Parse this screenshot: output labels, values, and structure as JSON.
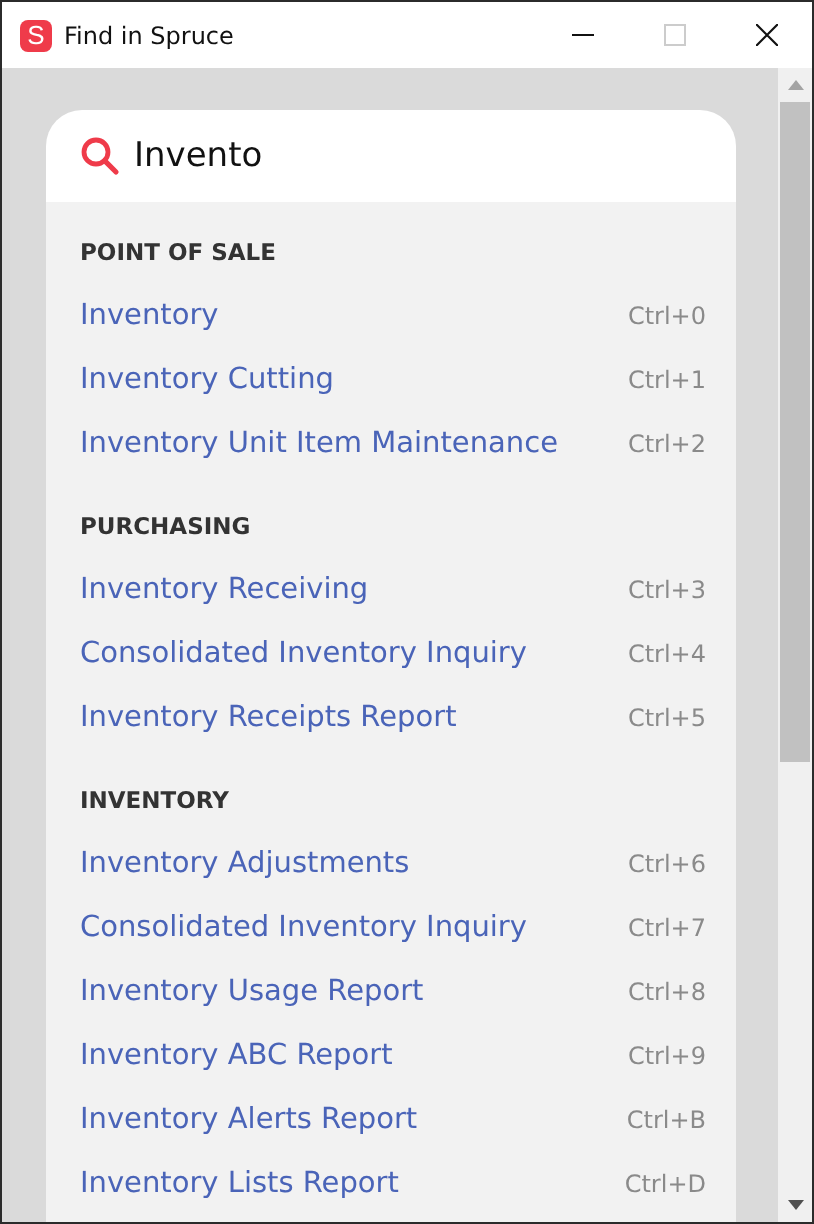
{
  "window": {
    "title": "Find in Spruce",
    "logo": "S"
  },
  "search": {
    "value": "Invento"
  },
  "sections": [
    {
      "header": "POINT OF SALE",
      "items": [
        {
          "label": "Inventory",
          "shortcut": "Ctrl+0"
        },
        {
          "label": "Inventory Cutting",
          "shortcut": "Ctrl+1"
        },
        {
          "label": "Inventory Unit Item Maintenance",
          "shortcut": "Ctrl+2"
        }
      ]
    },
    {
      "header": "PURCHASING",
      "items": [
        {
          "label": "Inventory Receiving",
          "shortcut": "Ctrl+3"
        },
        {
          "label": "Consolidated Inventory Inquiry",
          "shortcut": "Ctrl+4"
        },
        {
          "label": "Inventory Receipts Report",
          "shortcut": "Ctrl+5"
        }
      ]
    },
    {
      "header": "INVENTORY",
      "items": [
        {
          "label": "Inventory Adjustments",
          "shortcut": "Ctrl+6"
        },
        {
          "label": "Consolidated Inventory Inquiry",
          "shortcut": "Ctrl+7"
        },
        {
          "label": "Inventory Usage Report",
          "shortcut": "Ctrl+8"
        },
        {
          "label": "Inventory ABC Report",
          "shortcut": "Ctrl+9"
        },
        {
          "label": "Inventory Alerts Report",
          "shortcut": "Ctrl+B"
        },
        {
          "label": "Inventory Lists Report",
          "shortcut": "Ctrl+D"
        }
      ]
    }
  ]
}
